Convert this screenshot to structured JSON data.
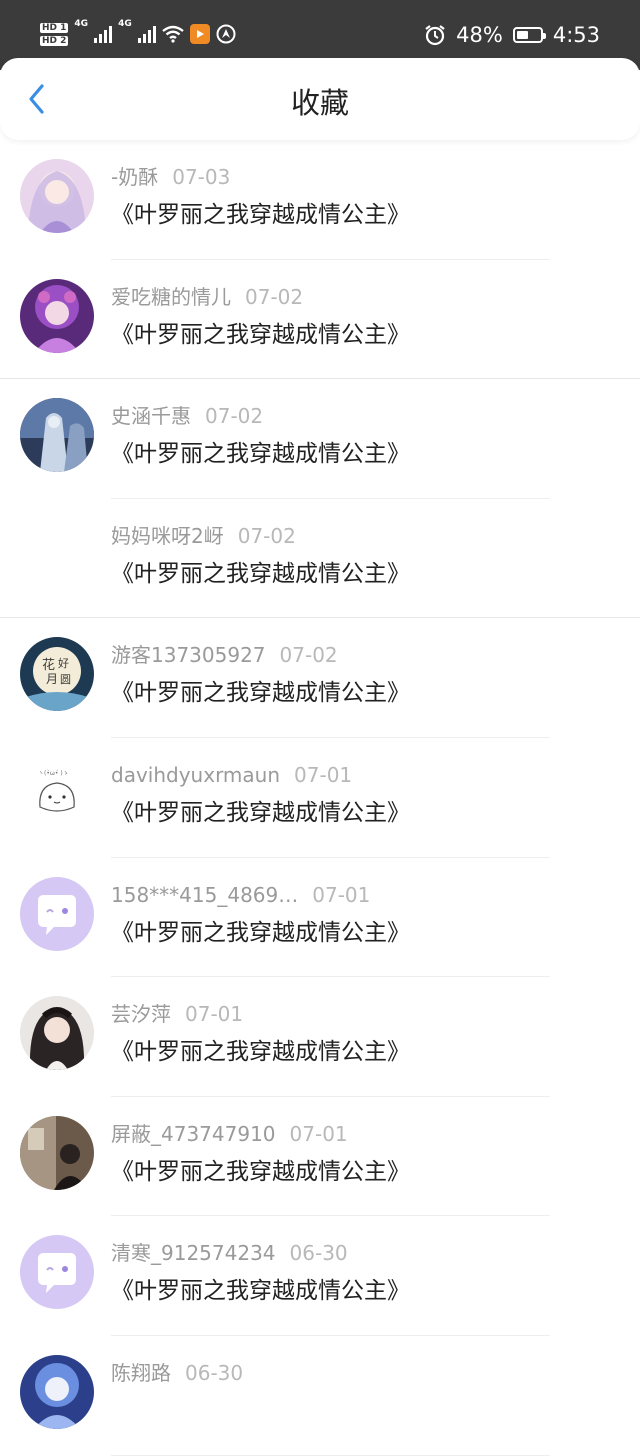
{
  "status": {
    "battery": "48%",
    "time": "4:53",
    "battery_level": 0.48
  },
  "header": {
    "title": "收藏"
  },
  "items": [
    {
      "name": "-奶酥",
      "date": "07-03",
      "title": "《叶罗丽之我穿越成情公主》",
      "avatar": "pink-anime-girl"
    },
    {
      "name": "爱吃糖的情儿",
      "date": "07-02",
      "title": "《叶罗丽之我穿越成情公主》",
      "avatar": "purple-anime-girl"
    },
    {
      "name": "史涵千惠",
      "date": "07-02",
      "title": "《叶罗丽之我穿越成情公主》",
      "avatar": "blue-anime-couple"
    },
    {
      "name": "妈妈咪呀2岈",
      "date": "07-02",
      "title": "《叶罗丽之我穿越成情公主》",
      "avatar": "none"
    },
    {
      "name": "游客137305927",
      "date": "07-02",
      "title": "《叶罗丽之我穿越成情公主》",
      "avatar": "moon-badge"
    },
    {
      "name": "davihdyuxrmaun",
      "date": "07-01",
      "title": "《叶罗丽之我穿越成情公主》",
      "avatar": "cartoon-bun"
    },
    {
      "name": "158***415_4869…",
      "date": "07-01",
      "title": "《叶罗丽之我穿越成情公主》",
      "avatar": "default-chat"
    },
    {
      "name": "芸汐萍",
      "date": "07-01",
      "title": "《叶罗丽之我穿越成情公主》",
      "avatar": "gothic-doll"
    },
    {
      "name": "屏蔽_473747910",
      "date": "07-01",
      "title": "《叶罗丽之我穿越成情公主》",
      "avatar": "dark-photo"
    },
    {
      "name": "清寒_912574234",
      "date": "06-30",
      "title": "《叶罗丽之我穿越成情公主》",
      "avatar": "default-chat"
    },
    {
      "name": "陈翔路",
      "date": "06-30",
      "title": "",
      "avatar": "blue-anime-girl"
    }
  ],
  "colors": {
    "accent": "#3a8ee6",
    "default_avatar": "#d6c8f4"
  }
}
